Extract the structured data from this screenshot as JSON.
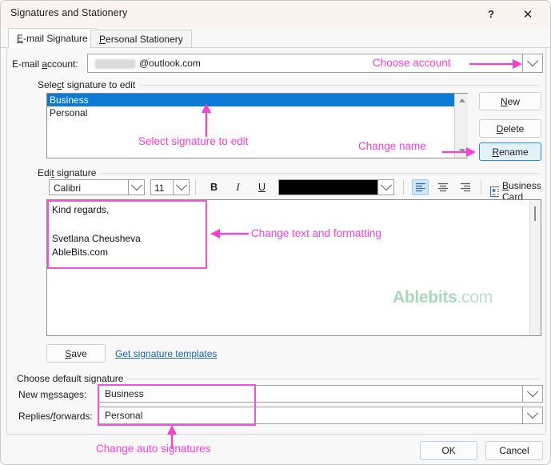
{
  "window": {
    "title": "Signatures and Stationery",
    "help_glyph": "?",
    "close_glyph": "✕"
  },
  "tabs": [
    {
      "label": "E-mail Signature",
      "accel": "E",
      "active": true
    },
    {
      "label": "Personal Stationery",
      "accel": "P",
      "active": false
    }
  ],
  "account": {
    "label_pre": "E-mail ",
    "label_accel": "a",
    "label_post": "ccount:",
    "value": "@outlook.com",
    "redacted": true
  },
  "select_group": {
    "title_pre": "Select signature to edit",
    "title_accel": "c",
    "items": [
      {
        "label": "Business",
        "selected": true
      },
      {
        "label": "Personal",
        "selected": false
      }
    ],
    "buttons": [
      {
        "label": "New",
        "accel": "N",
        "state": "normal"
      },
      {
        "label": "Delete",
        "accel": "D",
        "state": "normal"
      },
      {
        "label": "Rename",
        "accel": "R",
        "state": "focus"
      }
    ]
  },
  "edit_group": {
    "title": "Edit signature",
    "title_accel": "t",
    "toolbar": {
      "font_family": "Calibri",
      "font_size": "11",
      "bold": "B",
      "italic": "I",
      "underline": "U",
      "font_color": "#000000",
      "align_left": "align-left",
      "align_center": "align-center",
      "align_right": "align-right",
      "business_card_label": "Business Card",
      "business_card_accel": "B",
      "picture_icon": "insert-picture",
      "hyperlink_icon": "insert-hyperlink"
    },
    "signature_text": [
      "Kind regards,",
      "",
      "Svetlana Cheusheva",
      "AbleBits.com"
    ],
    "watermark_bold": "Ablebits",
    "watermark_light": ".com",
    "save_label": "Save",
    "save_accel": "S",
    "templates_link": "Get signature templates"
  },
  "default_group": {
    "title": "Choose default signature",
    "rows": [
      {
        "label_pre": "New m",
        "label_accel": "e",
        "label_post": "ssages:",
        "value": "Business"
      },
      {
        "label_pre": "Replies/",
        "label_accel": "f",
        "label_post": "orwards:",
        "value": "Personal"
      }
    ]
  },
  "footer": {
    "ok_label": "OK",
    "cancel_label": "Cancel"
  },
  "annotations": [
    {
      "id": "choose-account",
      "text": "Choose account"
    },
    {
      "id": "select-signature",
      "text": "Select signature to edit"
    },
    {
      "id": "change-name",
      "text": "Change name"
    },
    {
      "id": "change-text",
      "text": "Change text and formatting"
    },
    {
      "id": "change-auto",
      "text": "Change auto signatures"
    }
  ],
  "colors": {
    "annotation": "#fa3ed4",
    "selection": "#0a7ad6",
    "link": "#1763b5",
    "watermark": "#a8d8bd"
  }
}
